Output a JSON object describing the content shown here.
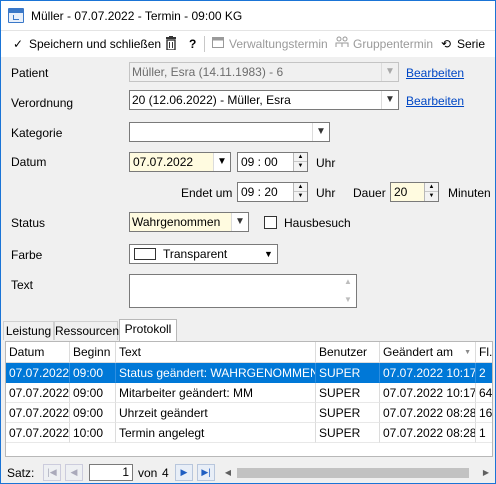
{
  "window": {
    "title": "Müller - 07.07.2022 - Termin - 09:00 KG"
  },
  "toolbar": {
    "save_label": "Speichern und schließen",
    "delete_icon": "trash-icon",
    "help_label": "?",
    "admin_label": "Verwaltungstermin",
    "group_label": "Gruppentermin",
    "series_label": "Serie"
  },
  "form": {
    "patient_label": "Patient",
    "patient_value": "Müller, Esra (14.11.1983) - 6",
    "patient_edit": "Bearbeiten",
    "prescription_label": "Verordnung",
    "prescription_value": "20 (12.06.2022) - Müller, Esra",
    "prescription_edit": "Bearbeiten",
    "category_label": "Kategorie",
    "category_value": "",
    "date_label": "Datum",
    "date_value": "07.07.2022",
    "time_value": "09 : 00",
    "time_unit": "Uhr",
    "end_label": "Endet um",
    "end_value": "09 : 20",
    "end_unit": "Uhr",
    "duration_label": "Dauer",
    "duration_value": "20",
    "duration_unit": "Minuten",
    "status_label": "Status",
    "status_value": "Wahrgenommen",
    "home_visit_label": "Hausbesuch",
    "home_visit_checked": false,
    "color_label": "Farbe",
    "color_value": "Transparent",
    "text_label": "Text",
    "text_value": ""
  },
  "tabs": [
    "Leistung",
    "Ressourcen",
    "Protokoll"
  ],
  "active_tab": "Protokoll",
  "grid": {
    "columns": [
      "Datum",
      "Beginn",
      "Text",
      "Benutzer",
      "Geändert am",
      "Fl."
    ],
    "rows": [
      [
        "07.07.2022",
        "09:00",
        "Status geändert: WAHRGENOMMEN",
        "SUPER",
        "07.07.2022 10:17",
        "2"
      ],
      [
        "07.07.2022",
        "09:00",
        "Mitarbeiter geändert: MM",
        "SUPER",
        "07.07.2022 10:17",
        "64"
      ],
      [
        "07.07.2022",
        "09:00",
        "Uhrzeit geändert",
        "SUPER",
        "07.07.2022 08:28",
        "16"
      ],
      [
        "07.07.2022",
        "10:00",
        "Termin angelegt",
        "SUPER",
        "07.07.2022 08:28",
        "1"
      ]
    ],
    "selected_row": 0
  },
  "nav": {
    "label": "Satz:",
    "current": "1",
    "of_label": "von",
    "total": "4"
  },
  "colors": {
    "selection": "#0078d7",
    "link": "#0047c5",
    "date_bg": "#fffbe0"
  }
}
